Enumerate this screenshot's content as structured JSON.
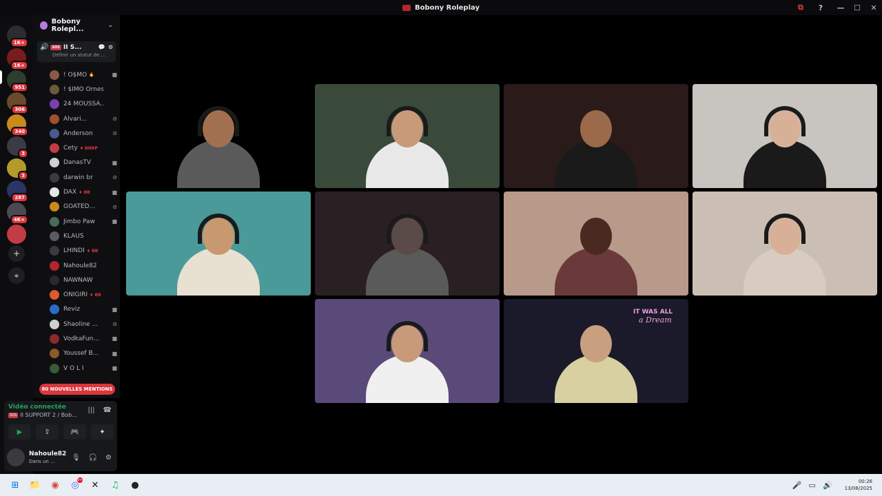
{
  "window": {
    "title": "Bobony Roleplay",
    "controls": {
      "cast": "⧉",
      "help": "?",
      "minimize": "—",
      "maximize": "☐",
      "close": "✕"
    }
  },
  "rail": {
    "servers": [
      {
        "color": "#2b2d31",
        "badge": "1K+"
      },
      {
        "color": "#7a1c1c",
        "badge": "1K+"
      },
      {
        "color": "#2e3d2e",
        "badge": "951"
      },
      {
        "color": "#6b4a2a",
        "badge": "306"
      },
      {
        "color": "#c98a1a",
        "badge": "340"
      },
      {
        "color": "#3b3b45",
        "badge": "3"
      },
      {
        "color": "#b59a2a",
        "badge": "3"
      },
      {
        "color": "#2a3566",
        "badge": "287"
      },
      {
        "color": "#4a4a50",
        "badge": "4K+"
      },
      {
        "color": "#c23b45",
        "badge": ""
      }
    ],
    "add_label": "+",
    "explore_label": "⌖"
  },
  "sidebar": {
    "server_name": "Bobony Rolepl...",
    "channel": {
      "name": "II S...",
      "tag": "SOS",
      "status": "Définir un statut de ...",
      "icons": [
        "💬",
        "⚙"
      ]
    },
    "members": [
      {
        "name": "! O$MO",
        "ext": "🔥",
        "color": "#8a5a44",
        "st": "■"
      },
      {
        "name": "! $IMO Ornes...",
        "ext": "",
        "color": "#6b5a3a",
        "st": ""
      },
      {
        "name": "24 MOUSSA...",
        "ext": "",
        "color": "#7b3fb5",
        "st": ""
      },
      {
        "name": "Alvari...",
        "ext": "",
        "color": "#a0522d",
        "st": "⊘"
      },
      {
        "name": "Anderson",
        "ext": "",
        "color": "#4a5a8a",
        "st": "⊘"
      },
      {
        "name": "Cety",
        "ext": "♦ BNRP",
        "color": "#c23b45",
        "st": ""
      },
      {
        "name": "DanasTV",
        "ext": "",
        "color": "#cfcfcf",
        "st": "■"
      },
      {
        "name": "darwin br",
        "ext": "",
        "color": "#3a3a40",
        "st": "⊘"
      },
      {
        "name": "DAX",
        "ext": "♦ BB",
        "color": "#e6e6e6",
        "st": "■"
      },
      {
        "name": "GOATED...",
        "ext": "",
        "color": "#c98a1a",
        "st": "⊘"
      },
      {
        "name": "Jimbo Paw",
        "ext": "",
        "color": "#4a6a5a",
        "st": "■"
      },
      {
        "name": "KLAUS",
        "ext": "",
        "color": "#5a5a66",
        "st": ""
      },
      {
        "name": "LHINDI",
        "ext": "♦ BB",
        "color": "#3a3a3a",
        "st": ""
      },
      {
        "name": "Nahoule82",
        "ext": "",
        "color": "#b3262e",
        "st": ""
      },
      {
        "name": "NAWNAW",
        "ext": "",
        "color": "#2a2a2a",
        "st": ""
      },
      {
        "name": "ONIGIRI",
        "ext": "♦ BB",
        "color": "#e05a2a",
        "st": ""
      },
      {
        "name": "Reviz",
        "ext": "",
        "color": "#2a6ac9",
        "st": "■"
      },
      {
        "name": "Shaoline ...",
        "ext": "",
        "color": "#cfcfcf",
        "st": "⊘"
      },
      {
        "name": "VodkaFun...",
        "ext": "",
        "color": "#8a2a2a",
        "st": "■"
      },
      {
        "name": "Youssef B...",
        "ext": "",
        "color": "#8a5a2a",
        "st": "■"
      },
      {
        "name": "V O L I",
        "ext": "",
        "color": "#3a5a3a",
        "st": "■"
      }
    ],
    "mentions_label": "80 NOUVELLES MENTIONS"
  },
  "voice": {
    "connected_label": "Vidéo connectée",
    "channel_tag": "SOS",
    "channel_label": "II SUPPORT 2 / Bob...",
    "buttons": [
      "▶",
      "⇪",
      "🎮",
      "✦"
    ]
  },
  "user": {
    "name": "Nahoule82",
    "status": "Dans un ..."
  },
  "tiles": [
    {
      "bg": "#000000",
      "skin": "#a07050",
      "shirt": "#5a5a5a",
      "hs": true
    },
    {
      "bg": "#3a4a3a",
      "skin": "#c89a7a",
      "shirt": "#e8e8e8",
      "hs": true
    },
    {
      "bg": "#2a1a1a",
      "skin": "#9a6a4a",
      "shirt": "#1a1a1a",
      "hs": false
    },
    {
      "bg": "#c8c4c0",
      "skin": "#d8b098",
      "shirt": "#1a1a1a",
      "hs": true
    },
    {
      "bg": "#4a9a9a",
      "skin": "#c89870",
      "shirt": "#e8e0d0",
      "hs": true
    },
    {
      "bg": "#2a2024",
      "skin": "#5a4a48",
      "shirt": "#5a5a5a",
      "hs": true
    },
    {
      "bg": "#b89a8a",
      "skin": "#4a2a20",
      "shirt": "#6a3a3a",
      "hs": false
    },
    {
      "bg": "#cbbfb3",
      "skin": "#d8b098",
      "shirt": "#d8ccc0",
      "hs": true
    },
    {
      "bg": "#5a4a7a",
      "skin": "#c89a7a",
      "shirt": "#f0f0f0",
      "hs": true
    },
    {
      "bg": "#1a1a2a",
      "skin": "#c8a080",
      "shirt": "#d8d0a0",
      "hs": false
    }
  ],
  "tile8_text": {
    "line1": "IT WAS ALL",
    "line2": "a Dream"
  },
  "taskbar": {
    "apps": [
      "⊞",
      "📁",
      "◉",
      "◎",
      "✕",
      "♫",
      "●"
    ],
    "tray": [
      "🎤",
      "▭",
      "🔊"
    ],
    "time": "00:26",
    "date": "13/08/2025",
    "discord_badge": "9+"
  }
}
